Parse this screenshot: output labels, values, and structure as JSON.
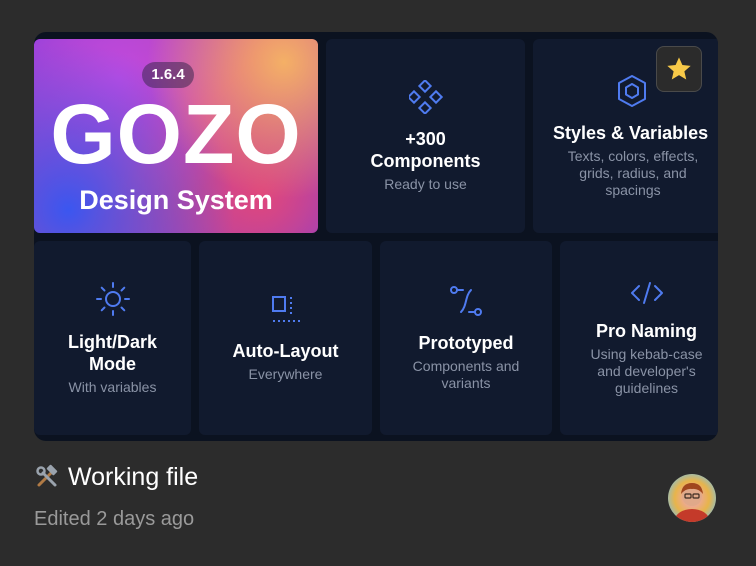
{
  "hero": {
    "version": "1.6.4",
    "title": "GOZO",
    "subtitle": "Design System"
  },
  "cards": {
    "components": {
      "title_line1": "+300",
      "title_line2": "Components",
      "sub": "Ready to use",
      "icon": "components-icon"
    },
    "styles": {
      "title": "Styles & Variables",
      "sub_line1": "Texts, colors, effects,",
      "sub_line2": "grids, radius, and",
      "sub_line3": "spacings",
      "icon": "cube-icon"
    },
    "lightdark": {
      "title_line1": "Light/Dark",
      "title_line2": "Mode",
      "sub": "With variables",
      "icon": "sun-icon"
    },
    "autolayout": {
      "title": "Auto-Layout",
      "sub": "Everywhere",
      "icon": "auto-layout-icon"
    },
    "prototyped": {
      "title": "Prototyped",
      "sub_line1": "Components and",
      "sub_line2": "variants",
      "icon": "prototype-path-icon"
    },
    "naming": {
      "title": "Pro Naming",
      "sub_line1": "Using kebab-case",
      "sub_line2": "and developer's",
      "sub_line3": "guidelines",
      "icon": "code-icon"
    }
  },
  "file": {
    "name": "Working file",
    "edited": "Edited 2 days ago",
    "icon": "hammer-wrench-icon"
  },
  "colors": {
    "background": "#2c2c2c",
    "card": "#111a2e",
    "accent_icon": "#4f7bf0",
    "star": "#f7c948"
  }
}
